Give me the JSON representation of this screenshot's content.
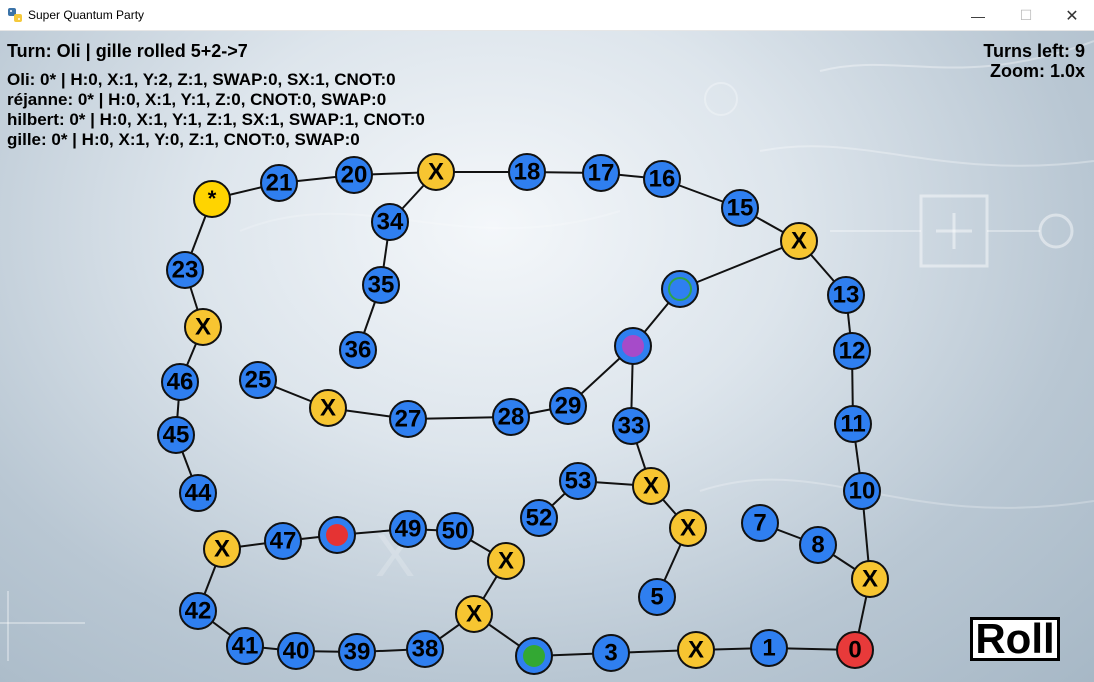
{
  "window": {
    "title": "Super Quantum Party",
    "controls": {
      "minimize": "—",
      "maximize": "☐",
      "close": "✕"
    }
  },
  "hud": {
    "turn_line": "Turn: Oli  |  gille rolled 5+2->7",
    "turns_left": "Turns left: 9",
    "zoom": "Zoom: 1.0x"
  },
  "players": [
    "Oli: 0* | H:0, X:1, Y:2, Z:1, SWAP:0, SX:1, CNOT:0",
    "réjanne: 0* | H:0, X:1, Y:1, Z:0, CNOT:0, SWAP:0",
    "hilbert: 0* | H:0, X:1, Y:1, Z:1, SX:1, SWAP:1, CNOT:0",
    "gille: 0* | H:0, X:1, Y:0, Z:1, CNOT:0, SWAP:0"
  ],
  "roll_button": "Roll",
  "colors": {
    "blue_tile": "#2f7ff0",
    "gate_tile": "#f7c531",
    "start_tile": "#e83a3a",
    "star_tile": "#ffd400",
    "token_green": "#33a833",
    "token_red": "#e53333",
    "token_purple": "#a64bc9",
    "token_blue": "#2f7ff0"
  },
  "board": {
    "tiles": [
      {
        "label": "0",
        "kind": "start"
      },
      {
        "label": "1",
        "kind": "number"
      },
      {
        "label": "X",
        "kind": "gate"
      },
      {
        "label": "3",
        "kind": "number"
      },
      {
        "label": "",
        "kind": "occupied",
        "token": "green"
      },
      {
        "label": "X",
        "kind": "gate"
      },
      {
        "label": "X",
        "kind": "gate"
      },
      {
        "label": "50",
        "kind": "number"
      },
      {
        "label": "49",
        "kind": "number"
      },
      {
        "label": "",
        "kind": "occupied",
        "token": "red"
      },
      {
        "label": "47",
        "kind": "number"
      },
      {
        "label": "X",
        "kind": "gate"
      },
      {
        "label": "42",
        "kind": "number"
      },
      {
        "label": "41",
        "kind": "number"
      },
      {
        "label": "40",
        "kind": "number"
      },
      {
        "label": "39",
        "kind": "number"
      },
      {
        "label": "38",
        "kind": "number"
      },
      {
        "label": "X",
        "kind": "gate"
      },
      {
        "label": "8",
        "kind": "number"
      },
      {
        "label": "7",
        "kind": "number"
      },
      {
        "label": "10",
        "kind": "number"
      },
      {
        "label": "11",
        "kind": "number"
      },
      {
        "label": "12",
        "kind": "number"
      },
      {
        "label": "13",
        "kind": "number"
      },
      {
        "label": "X",
        "kind": "gate"
      },
      {
        "label": "15",
        "kind": "number"
      },
      {
        "label": "16",
        "kind": "number"
      },
      {
        "label": "17",
        "kind": "number"
      },
      {
        "label": "18",
        "kind": "number"
      },
      {
        "label": "X",
        "kind": "gate"
      },
      {
        "label": "20",
        "kind": "number"
      },
      {
        "label": "21",
        "kind": "number"
      },
      {
        "label": "*",
        "kind": "star"
      },
      {
        "label": "23",
        "kind": "number"
      },
      {
        "label": "X",
        "kind": "gate"
      },
      {
        "label": "46",
        "kind": "number"
      },
      {
        "label": "45",
        "kind": "number"
      },
      {
        "label": "44",
        "kind": "number"
      },
      {
        "label": "34",
        "kind": "number"
      },
      {
        "label": "35",
        "kind": "number"
      },
      {
        "label": "36",
        "kind": "number"
      },
      {
        "label": "",
        "kind": "occupied",
        "token": "blue"
      },
      {
        "label": "",
        "kind": "occupied",
        "token": "purple"
      },
      {
        "label": "33",
        "kind": "number"
      },
      {
        "label": "X",
        "kind": "gate"
      },
      {
        "label": "53",
        "kind": "number"
      },
      {
        "label": "52",
        "kind": "number"
      },
      {
        "label": "X",
        "kind": "gate"
      },
      {
        "label": "5",
        "kind": "number"
      },
      {
        "label": "29",
        "kind": "number"
      },
      {
        "label": "28",
        "kind": "number"
      },
      {
        "label": "27",
        "kind": "number"
      },
      {
        "label": "X",
        "kind": "gate"
      },
      {
        "label": "25",
        "kind": "number"
      }
    ]
  }
}
